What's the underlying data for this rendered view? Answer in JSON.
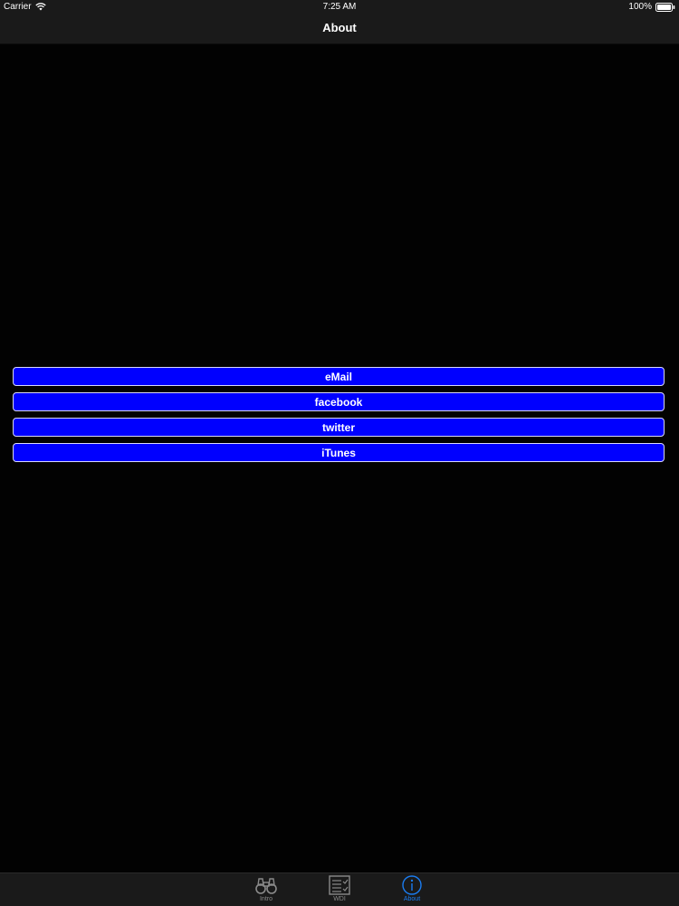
{
  "status_bar": {
    "carrier": "Carrier",
    "time": "7:25 AM",
    "battery": "100%"
  },
  "nav": {
    "title": "About"
  },
  "buttons": [
    {
      "label": "eMail"
    },
    {
      "label": "facebook"
    },
    {
      "label": "twitter"
    },
    {
      "label": "iTunes"
    }
  ],
  "tabs": [
    {
      "label": "Intro",
      "icon": "binoculars-icon",
      "active": false
    },
    {
      "label": "WDI",
      "icon": "document-list-icon",
      "active": false
    },
    {
      "label": "About",
      "icon": "info-icon",
      "active": true
    }
  ],
  "colors": {
    "button_fill": "#0000ff",
    "button_border": "#d8d8ff",
    "active_tab": "#1a7cf0",
    "inactive_tab": "#8a8a8a",
    "bar_background": "#1a1a1a",
    "background": "#020202"
  }
}
